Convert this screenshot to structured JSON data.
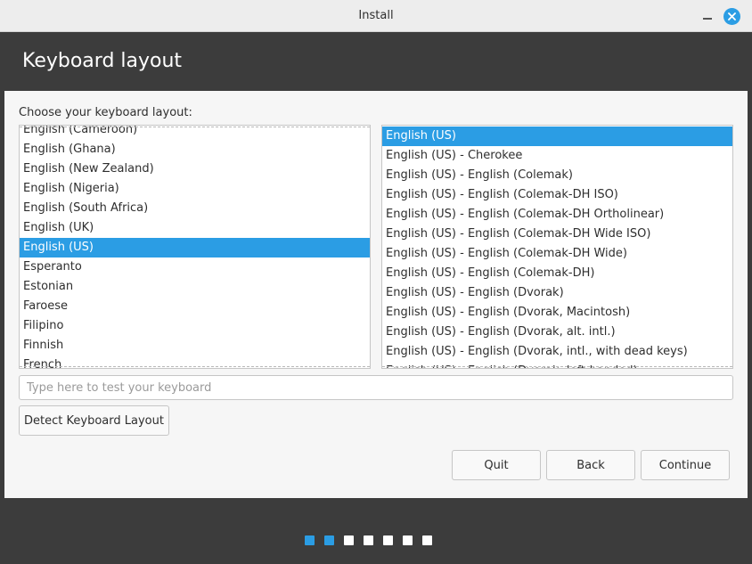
{
  "window": {
    "title": "Install"
  },
  "header": {
    "title": "Keyboard layout"
  },
  "prompt": "Choose your keyboard layout:",
  "layouts": [
    {
      "label": "English (Cameroon)",
      "selected": false
    },
    {
      "label": "English (Ghana)",
      "selected": false
    },
    {
      "label": "English (New Zealand)",
      "selected": false
    },
    {
      "label": "English (Nigeria)",
      "selected": false
    },
    {
      "label": "English (South Africa)",
      "selected": false
    },
    {
      "label": "English (UK)",
      "selected": false
    },
    {
      "label": "English (US)",
      "selected": true
    },
    {
      "label": "Esperanto",
      "selected": false
    },
    {
      "label": "Estonian",
      "selected": false
    },
    {
      "label": "Faroese",
      "selected": false
    },
    {
      "label": "Filipino",
      "selected": false
    },
    {
      "label": "Finnish",
      "selected": false
    },
    {
      "label": "French",
      "selected": false
    }
  ],
  "variants": [
    {
      "label": "English (US)",
      "selected": true
    },
    {
      "label": "English (US) - Cherokee",
      "selected": false
    },
    {
      "label": "English (US) - English (Colemak)",
      "selected": false
    },
    {
      "label": "English (US) - English (Colemak-DH ISO)",
      "selected": false
    },
    {
      "label": "English (US) - English (Colemak-DH Ortholinear)",
      "selected": false
    },
    {
      "label": "English (US) - English (Colemak-DH Wide ISO)",
      "selected": false
    },
    {
      "label": "English (US) - English (Colemak-DH Wide)",
      "selected": false
    },
    {
      "label": "English (US) - English (Colemak-DH)",
      "selected": false
    },
    {
      "label": "English (US) - English (Dvorak)",
      "selected": false
    },
    {
      "label": "English (US) - English (Dvorak, Macintosh)",
      "selected": false
    },
    {
      "label": "English (US) - English (Dvorak, alt. intl.)",
      "selected": false
    },
    {
      "label": "English (US) - English (Dvorak, intl., with dead keys)",
      "selected": false
    },
    {
      "label": "English (US) - English (Dvorak, left-handed)",
      "selected": false
    }
  ],
  "test_input": {
    "value": "",
    "placeholder": "Type here to test your keyboard"
  },
  "buttons": {
    "detect": "Detect Keyboard Layout",
    "quit": "Quit",
    "back": "Back",
    "continue": "Continue"
  },
  "progress": {
    "total_steps": 7,
    "completed_steps": 2
  },
  "colors": {
    "accent": "#2b9de4",
    "dark_bg": "#3c3c3c",
    "content_bg": "#f6f6f6"
  }
}
